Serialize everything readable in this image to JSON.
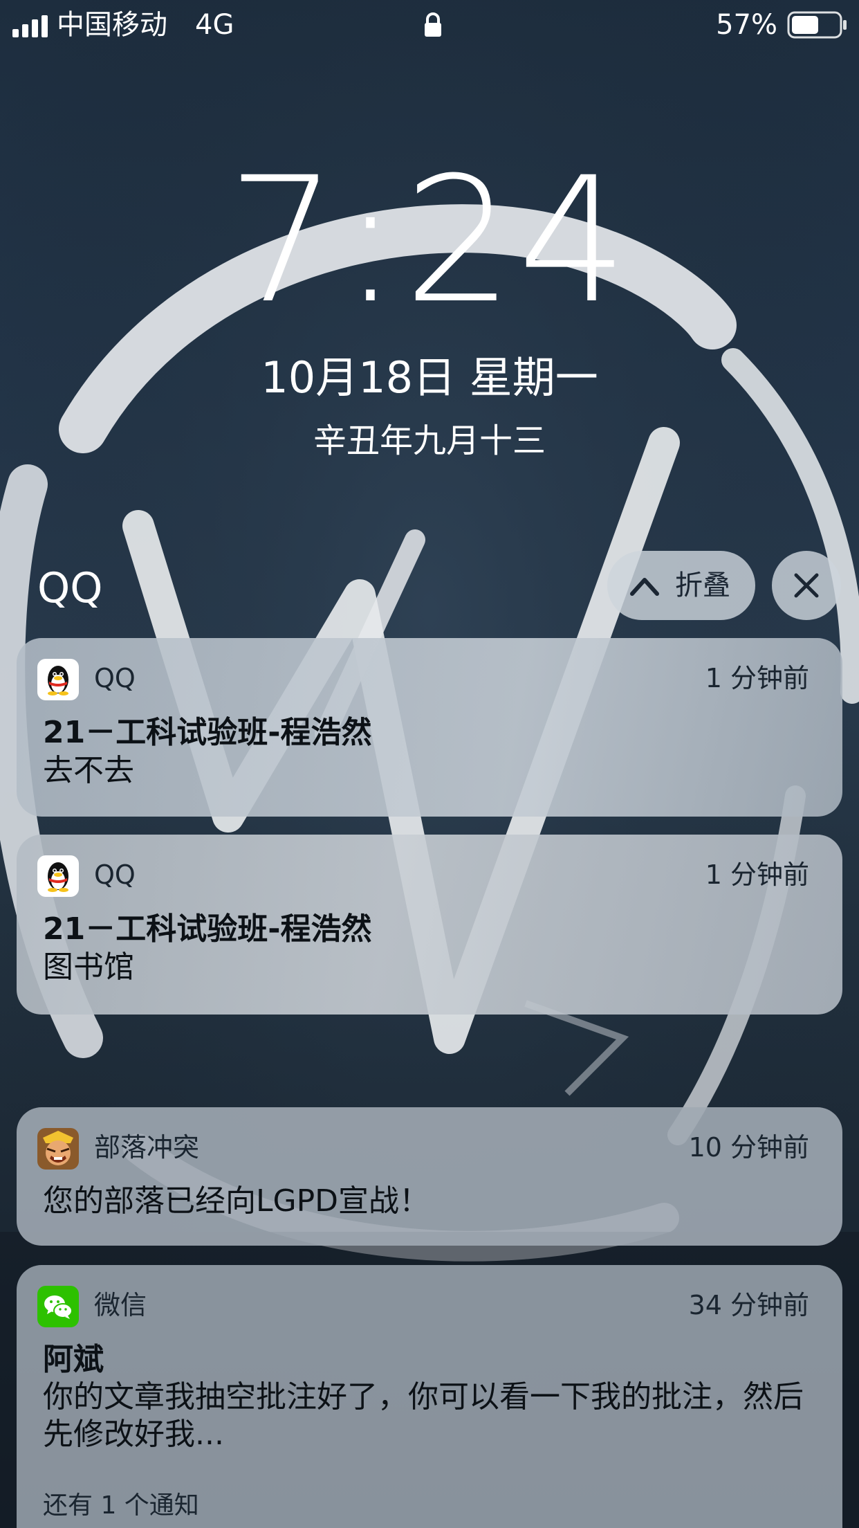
{
  "status_bar": {
    "carrier": "中国移动",
    "network": "4G",
    "battery_percent": "57%",
    "battery_level": 0.57,
    "signal_bars": 4,
    "icons": [
      "signal-icon",
      "lock-icon",
      "battery-icon"
    ]
  },
  "lockscreen": {
    "time": "7:24",
    "date": "10月18日 星期一",
    "lunar_date": "辛丑年九月十三"
  },
  "notification_group": {
    "title": "QQ",
    "collapse_label": "折叠",
    "collapse_icon": "chevron-up-icon",
    "close_icon": "close-icon"
  },
  "notifications": [
    {
      "app": "QQ",
      "icon": "qq-penguin-icon",
      "time": "1 分钟前",
      "title": "21－工科试验班-程浩然",
      "body": "去不去"
    },
    {
      "app": "QQ",
      "icon": "qq-penguin-icon",
      "time": "1 分钟前",
      "title": "21－工科试验班-程浩然",
      "body": "图书馆"
    },
    {
      "app": "部落冲突",
      "icon": "clash-of-clans-icon",
      "time": "10 分钟前",
      "body": "您的部落已经向LGPD宣战！"
    },
    {
      "app": "微信",
      "icon": "wechat-icon",
      "time": "34 分钟前",
      "title": "阿斌",
      "body": "你的文章我抽空批注好了，你可以看一下我的批注，然后先修改好我...",
      "more": "还有 1 个通知"
    }
  ],
  "colors": {
    "card_bg": "#bec6cf",
    "text_dark": "#0c1116",
    "wallpaper_dark": "#1d2d3e",
    "wechat_green": "#2dc100",
    "qq_yellow": "#f6c21a",
    "qq_red": "#e02a20"
  }
}
